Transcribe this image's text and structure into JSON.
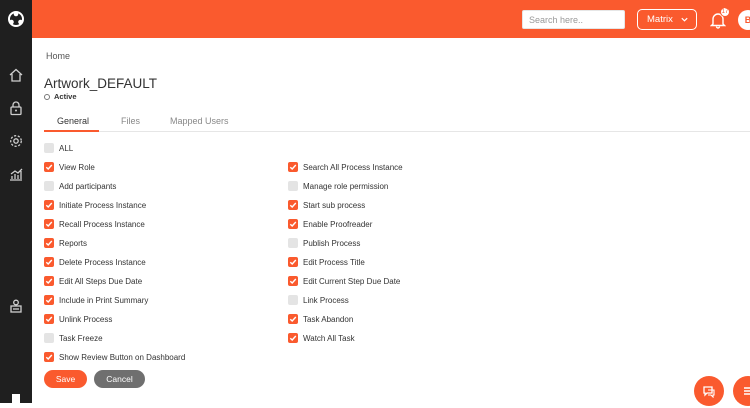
{
  "header": {
    "search_placeholder": "Search here..",
    "org_selector": "Matrix",
    "notification_count": "17",
    "avatar_initial": "B"
  },
  "breadcrumb": "Home",
  "page": {
    "title": "Artwork_DEFAULT",
    "status": "Active"
  },
  "tabs": [
    {
      "label": "General",
      "active": true
    },
    {
      "label": "Files",
      "active": false
    },
    {
      "label": "Mapped Users",
      "active": false
    }
  ],
  "permissions_left": [
    {
      "label": "ALL",
      "checked": false
    },
    {
      "label": "View Role",
      "checked": true
    },
    {
      "label": "Add participants",
      "checked": false
    },
    {
      "label": "Initiate Process Instance",
      "checked": true
    },
    {
      "label": "Recall Process Instance",
      "checked": true
    },
    {
      "label": "Reports",
      "checked": true
    },
    {
      "label": "Delete Process Instance",
      "checked": true
    },
    {
      "label": "Edit All Steps Due Date",
      "checked": true
    },
    {
      "label": "Include in Print Summary",
      "checked": true
    },
    {
      "label": "Unlink Process",
      "checked": true
    },
    {
      "label": "Task Freeze",
      "checked": false
    },
    {
      "label": "Show Review Button on Dashboard",
      "checked": true
    }
  ],
  "permissions_right": [
    {
      "label": "Search All Process Instance",
      "checked": true
    },
    {
      "label": "Manage role permission",
      "checked": false
    },
    {
      "label": "Start sub process",
      "checked": true
    },
    {
      "label": "Enable Proofreader",
      "checked": true
    },
    {
      "label": "Publish Process",
      "checked": false
    },
    {
      "label": "Edit Process Title",
      "checked": true
    },
    {
      "label": "Edit Current Step Due Date",
      "checked": true
    },
    {
      "label": "Link Process",
      "checked": false
    },
    {
      "label": "Task Abandon",
      "checked": true
    },
    {
      "label": "Watch All Task",
      "checked": true
    }
  ],
  "actions": {
    "save": "Save",
    "cancel": "Cancel"
  },
  "colors": {
    "accent": "#fa5a2e",
    "sidebar": "#1f1f1f",
    "checkbox_off": "#e4e4e4",
    "cancel": "#6f6f6f"
  }
}
